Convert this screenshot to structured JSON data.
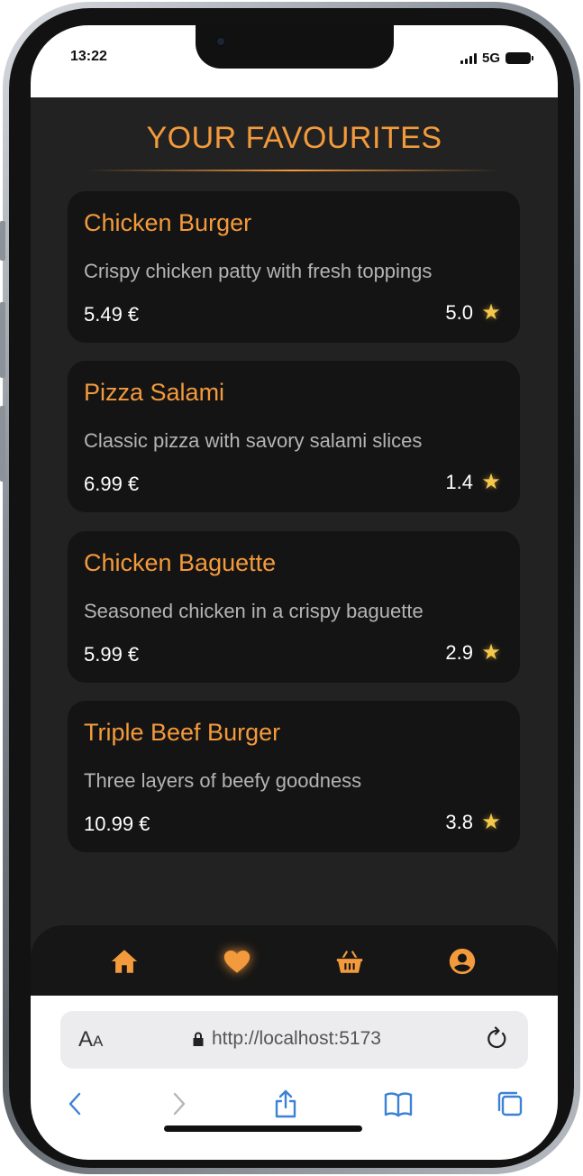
{
  "status_bar": {
    "time": "13:22",
    "network": "5G"
  },
  "page": {
    "title": "YOUR FAVOURITES",
    "accent_color": "#f39a3c"
  },
  "favourites": [
    {
      "name": "Chicken Burger",
      "description": "Crispy chicken patty with fresh toppings",
      "price": "5.49 €",
      "rating": "5.0"
    },
    {
      "name": "Pizza Salami",
      "description": "Classic pizza with savory salami slices",
      "price": "6.99 €",
      "rating": "1.4"
    },
    {
      "name": "Chicken Baguette",
      "description": "Seasoned chicken in a crispy baguette",
      "price": "5.99 €",
      "rating": "2.9"
    },
    {
      "name": "Triple Beef Burger",
      "description": "Three layers of beefy goodness",
      "price": "10.99 €",
      "rating": "3.8"
    }
  ],
  "bottom_nav": {
    "items": [
      {
        "icon": "home-icon"
      },
      {
        "icon": "heart-icon",
        "active": true
      },
      {
        "icon": "basket-icon"
      },
      {
        "icon": "user-icon"
      }
    ]
  },
  "browser": {
    "text_size_label_big": "A",
    "text_size_label_small": "A",
    "url": "http://localhost:5173"
  }
}
